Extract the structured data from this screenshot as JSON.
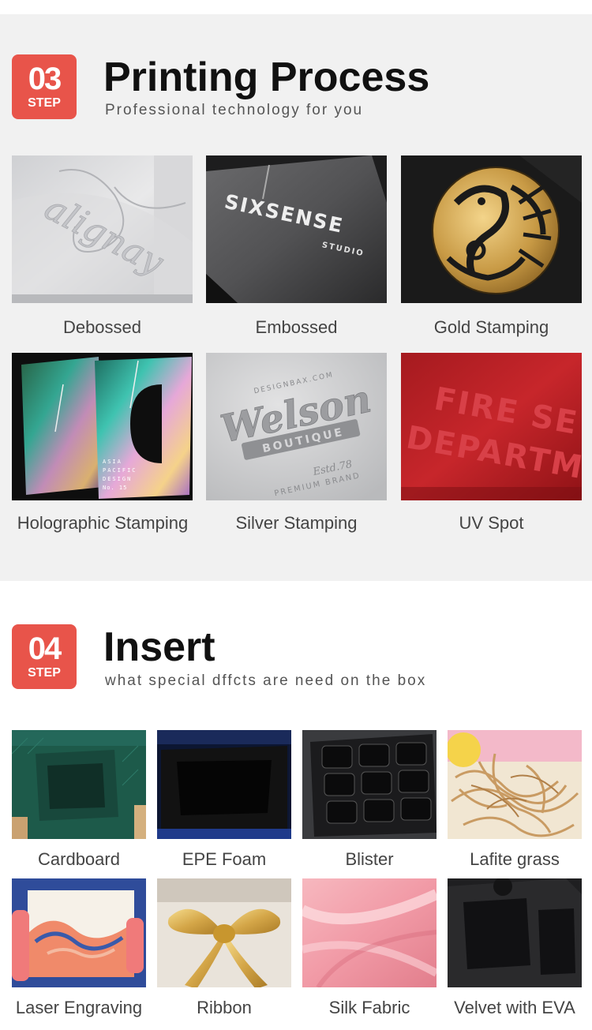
{
  "printing": {
    "step_number": "03",
    "step_word": "STEP",
    "title": "Printing Process",
    "subtitle": "Professional technology for you",
    "items": [
      {
        "label": "Debossed",
        "image_text": "alignay"
      },
      {
        "label": "Embossed",
        "image_text": "SIXSENSE",
        "image_subtext": "STUDIO"
      },
      {
        "label": "Gold Stamping"
      },
      {
        "label": "Holographic Stamping",
        "image_text": [
          "ASIA",
          "PACIFIC",
          "DESIGN",
          "No. 15"
        ]
      },
      {
        "label": "Silver Stamping",
        "image_text": [
          "Welson",
          "BOUTIQUE",
          "Estd.78",
          "PREMIUM BRAND",
          "DESIGNBAX.COM"
        ]
      },
      {
        "label": "UV Spot",
        "image_text": [
          "FIRE SE",
          "DEPARTM"
        ]
      }
    ]
  },
  "insert": {
    "step_number": "04",
    "step_word": "STEP",
    "title": "Insert",
    "subtitle": "what special dffcts are need on the box",
    "items": [
      {
        "label": "Cardboard"
      },
      {
        "label": "EPE Foam"
      },
      {
        "label": "Blister"
      },
      {
        "label": "Lafite grass"
      },
      {
        "label": "Laser Engraving"
      },
      {
        "label": "Ribbon"
      },
      {
        "label": "Silk Fabric"
      },
      {
        "label": "Velvet with EVA"
      }
    ]
  },
  "colors": {
    "accent": "#e8544a",
    "section_bg": "#f1f1f1"
  }
}
